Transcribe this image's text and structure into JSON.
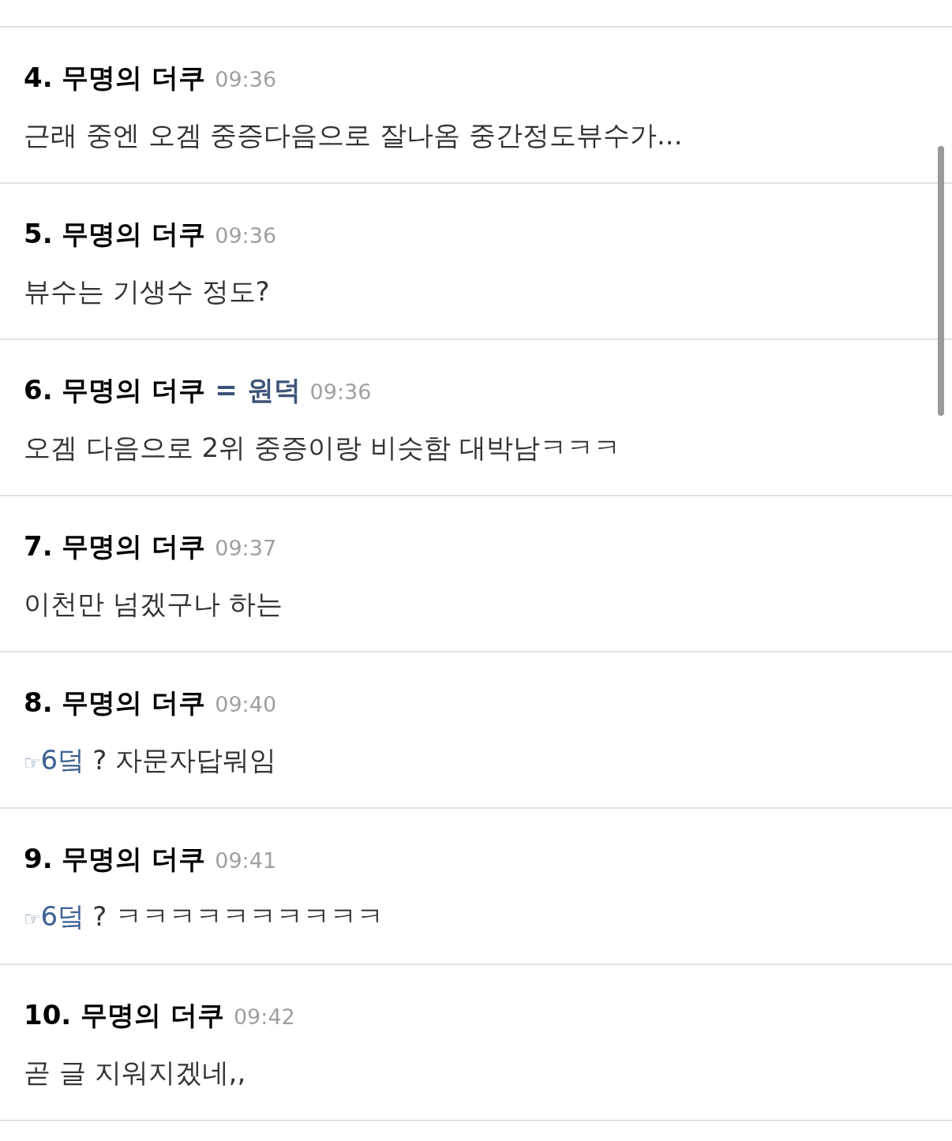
{
  "comments": [
    {
      "number": "4.",
      "author": "무명의 더쿠",
      "time": "09:36",
      "body": "근래 중엔 오겜 중증다음으로 잘나옴 중간정도뷰수가..."
    },
    {
      "number": "5.",
      "author": "무명의 더쿠",
      "time": "09:36",
      "body": "뷰수는 기생수 정도?"
    },
    {
      "number": "6.",
      "author": "무명의 더쿠",
      "op_tag": "= 원덕",
      "time": "09:36",
      "body": "오겜 다음으로 2위 중증이랑 비슷함 대박남ㅋㅋㅋ"
    },
    {
      "number": "7.",
      "author": "무명의 더쿠",
      "time": "09:37",
      "body": "이천만 넘겠구나 하는"
    },
    {
      "number": "8.",
      "author": "무명의 더쿠",
      "time": "09:40",
      "reply": {
        "pointer": "☞",
        "target": "6덬"
      },
      "body": "? 자문자답뭐임"
    },
    {
      "number": "9.",
      "author": "무명의 더쿠",
      "time": "09:41",
      "reply": {
        "pointer": "☞",
        "target": "6덬"
      },
      "body": "? ㅋㅋㅋㅋㅋㅋㅋㅋㅋㅋ"
    },
    {
      "number": "10.",
      "author": "무명의 더쿠",
      "time": "09:42",
      "body": "곧 글 지워지겠네,,"
    }
  ]
}
